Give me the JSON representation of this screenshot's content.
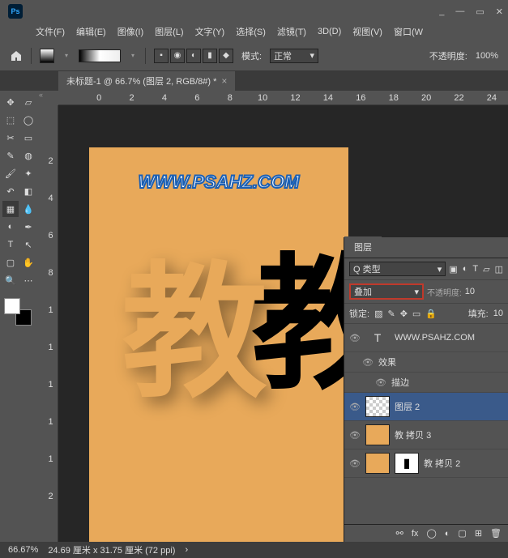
{
  "app": {
    "logo": "Ps"
  },
  "menu": {
    "file": "文件(F)",
    "edit": "编辑(E)",
    "image": "图像(I)",
    "layer": "图层(L)",
    "type": "文字(Y)",
    "select": "选择(S)",
    "filter": "滤镜(T)",
    "threed": "3D(D)",
    "view": "视图(V)",
    "window": "窗口(W"
  },
  "opts": {
    "mode_lbl": "模式:",
    "mode_val": "正常",
    "opacity_lbl": "不透明度:",
    "opacity_val": "100%"
  },
  "doc": {
    "tab": "未标题-1 @ 66.7% (图层 2, RGB/8#) *"
  },
  "ruler_h": [
    "0",
    "2",
    "4",
    "6",
    "8",
    "10",
    "12",
    "14",
    "16",
    "18",
    "20",
    "22",
    "24"
  ],
  "ruler_v": [
    "",
    "2",
    "4",
    "6",
    "8",
    "1",
    "1",
    "1",
    "1",
    "1",
    "2"
  ],
  "canvas": {
    "watermark": "WWW.PSAHZ.COM",
    "char1": "教",
    "char2": "教"
  },
  "layers_panel": {
    "tab": "图层",
    "kind_lbl": "Q 类型",
    "blend": "叠加",
    "opacity_lbl": "不透明度:",
    "opacity_val": "10",
    "lock_lbl": "锁定:",
    "fill_lbl": "填充:",
    "fill_val": "10",
    "items": [
      {
        "type": "text",
        "name": "WWW.PSAHZ.COM"
      },
      {
        "type": "fx_group",
        "name": "效果"
      },
      {
        "type": "fx_item",
        "name": "描边"
      },
      {
        "type": "layer",
        "name": "图层  2"
      },
      {
        "type": "layer",
        "name": "教 拷贝 3"
      },
      {
        "type": "layer_mask",
        "name": "教 拷贝 2"
      }
    ]
  },
  "status": {
    "zoom": "66.67%",
    "dims": "24.69 厘米 x 31.75 厘米 (72 ppi)"
  }
}
